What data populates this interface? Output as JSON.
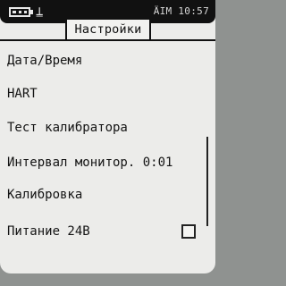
{
  "status_bar": {
    "battery_cells": 3,
    "lock_icon": "padlock-icon",
    "right_text": "ÄIM 10:57"
  },
  "header": {
    "title": "Настройки"
  },
  "menu": {
    "items": [
      {
        "label": "Дата/Время"
      },
      {
        "label": "HART"
      },
      {
        "label": "Тест калибратора"
      },
      {
        "label": "Интервал монитор. 0:01"
      },
      {
        "label": "Калибровка"
      },
      {
        "label": "Питание 24В",
        "checkbox": false
      }
    ]
  }
}
